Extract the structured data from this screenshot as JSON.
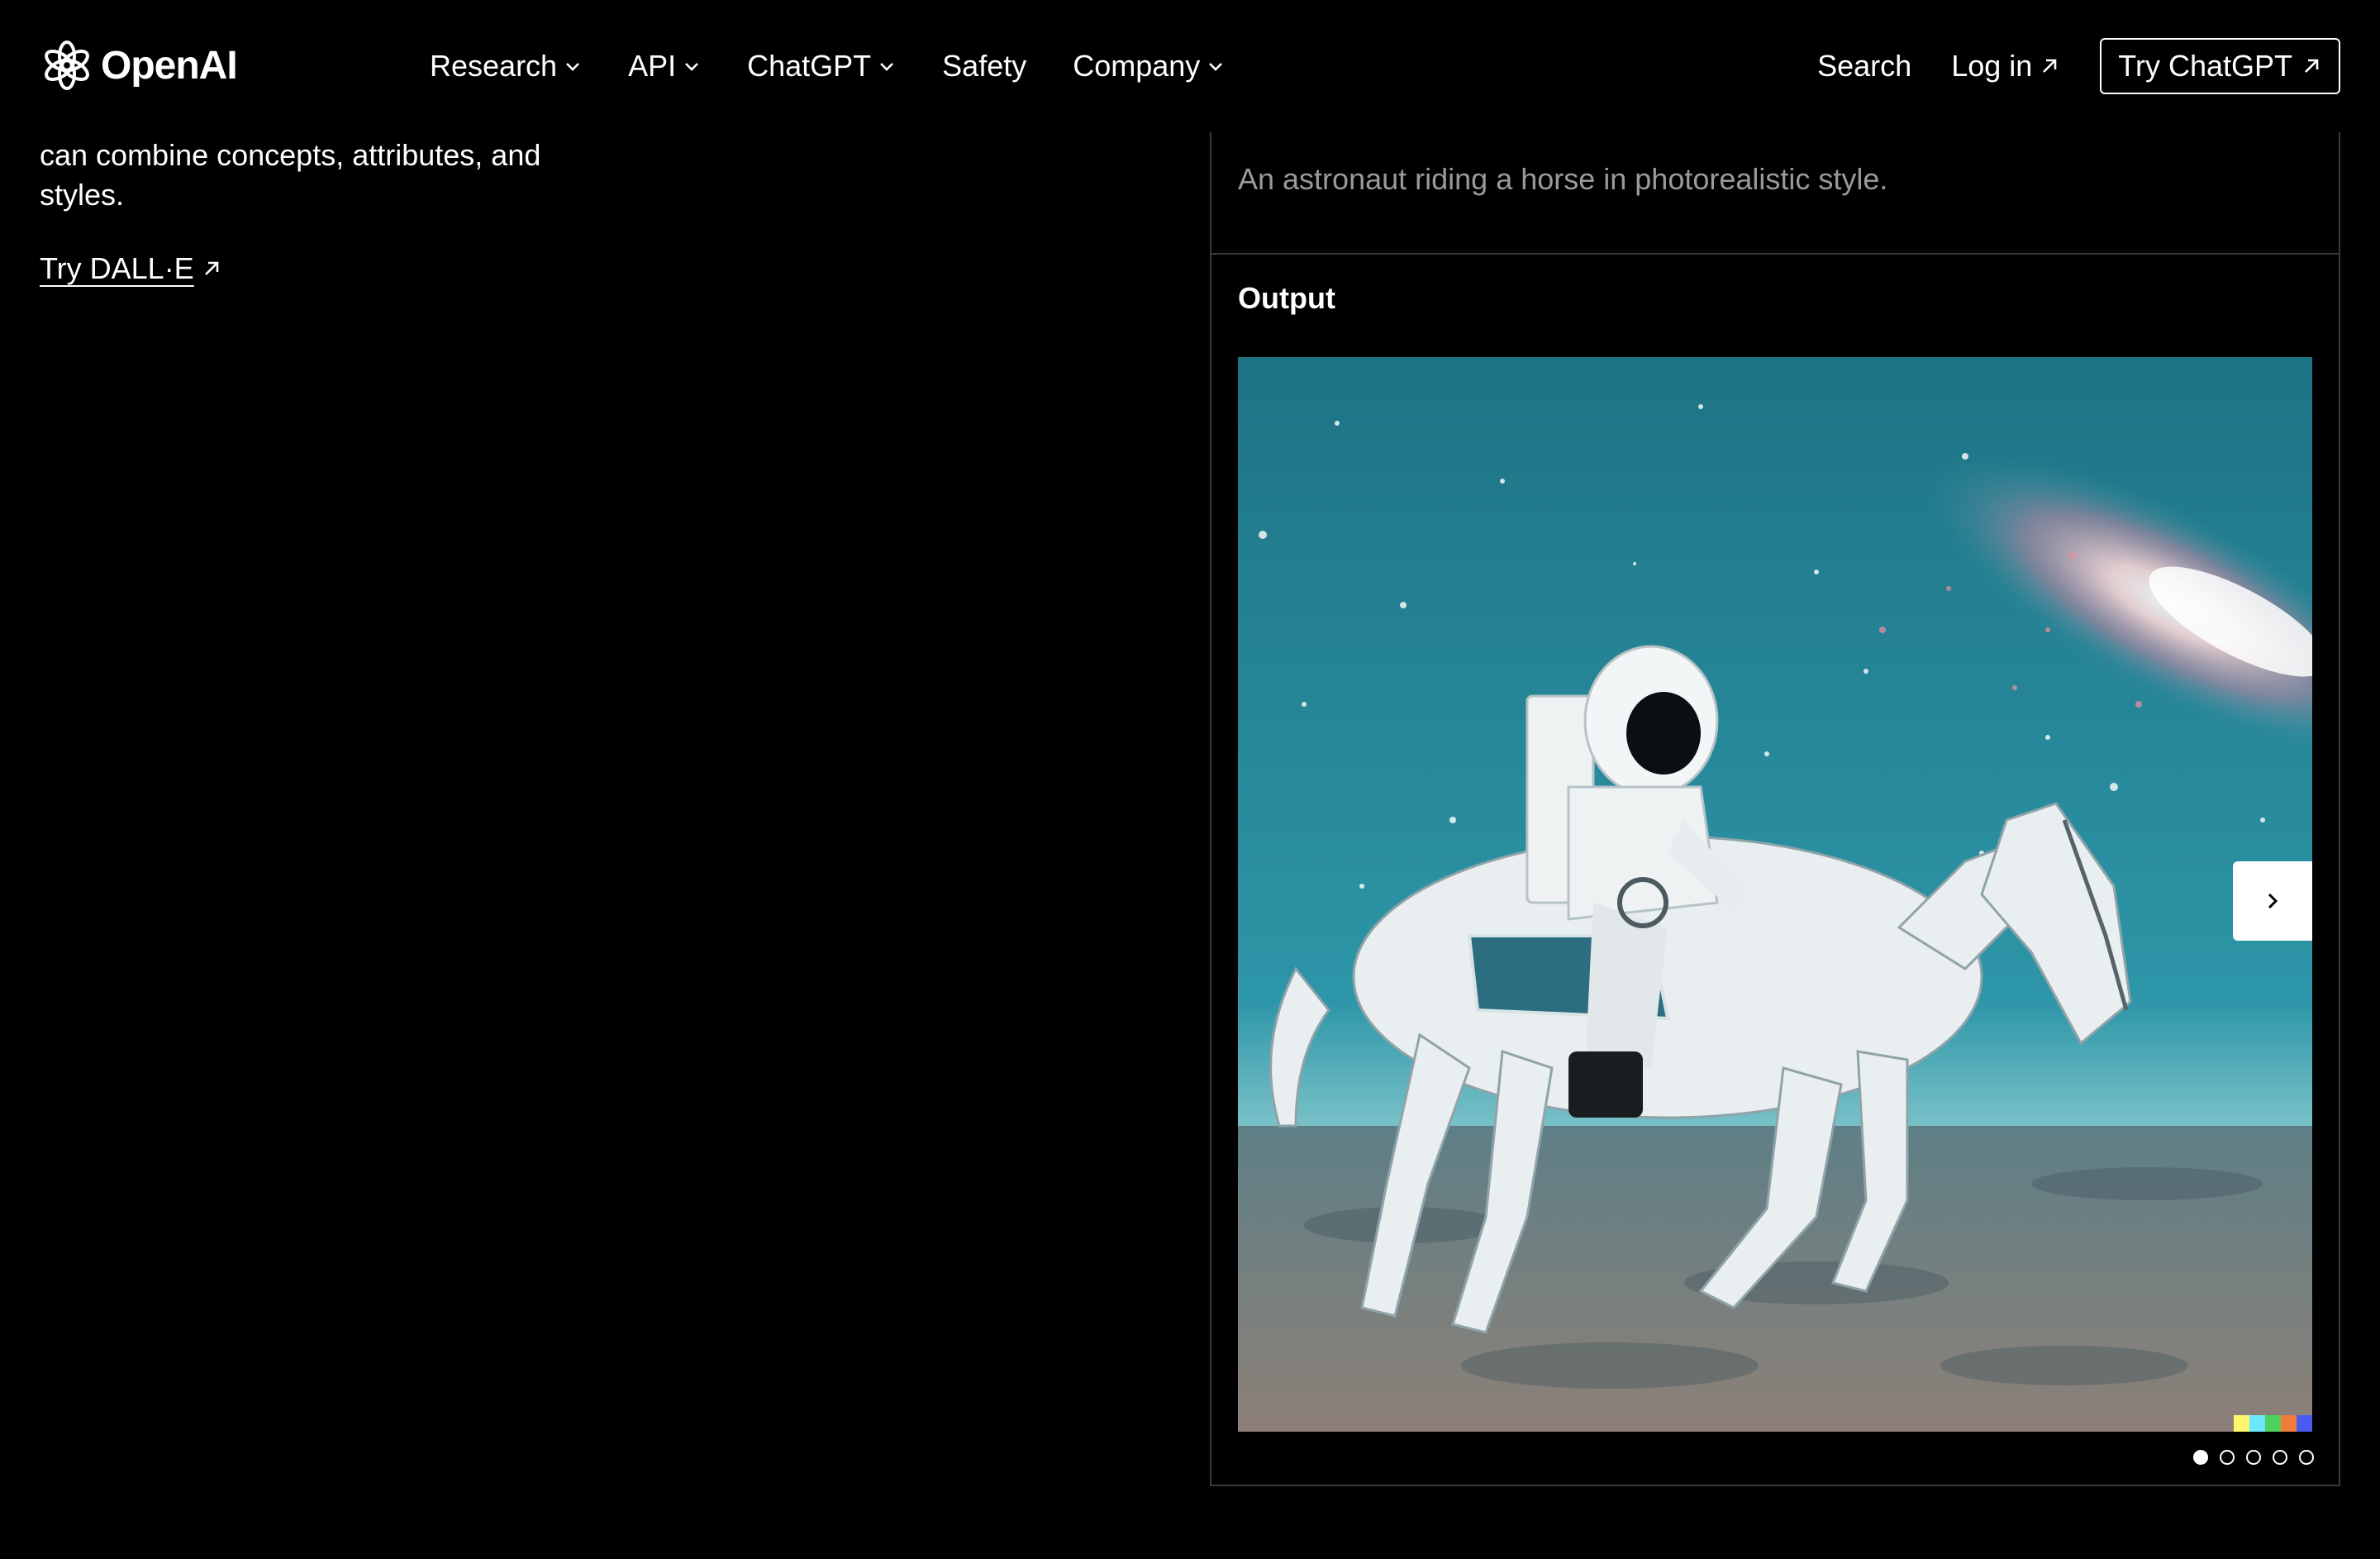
{
  "header": {
    "logo_text": "OpenAI",
    "nav": [
      {
        "label": "Research",
        "has_dropdown": true
      },
      {
        "label": "API",
        "has_dropdown": true
      },
      {
        "label": "ChatGPT",
        "has_dropdown": true
      },
      {
        "label": "Safety",
        "has_dropdown": false
      },
      {
        "label": "Company",
        "has_dropdown": true
      }
    ],
    "search_label": "Search",
    "login_label": "Log in",
    "try_chatgpt_label": "Try ChatGPT"
  },
  "left": {
    "line1": "can combine concepts, attributes, and",
    "line2": "styles.",
    "try_dalle_label": "Try DALL·E"
  },
  "panel": {
    "prompt": "An astronaut riding a horse in photorealistic style.",
    "output_label": "Output",
    "carousel": {
      "count": 5,
      "active_index": 0
    }
  },
  "colors": {
    "background": "#000000",
    "text": "#ffffff",
    "muted_text": "#9a9a9a",
    "border": "#3a3a3a"
  },
  "icons": {
    "logo": "openai-logo-icon",
    "dropdown": "chevron-down-icon",
    "external": "arrow-up-right-icon",
    "next": "chevron-right-icon"
  }
}
